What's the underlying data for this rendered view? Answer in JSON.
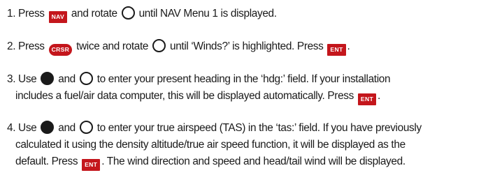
{
  "keys": {
    "nav": "NAV",
    "crsr": "CRSR",
    "ent": "ENT"
  },
  "icons": {
    "outer_knob": "outer-knob-icon",
    "inner_knob": "inner-knob-icon"
  },
  "colors": {
    "key_background": "#c4161c",
    "key_text": "#ffffff",
    "text": "#1a1a1a"
  },
  "steps": [
    {
      "a": "1. Press ",
      "b": " and rotate ",
      "c": " until NAV Menu 1 is displayed."
    },
    {
      "a": "2. Press ",
      "b": " twice and rotate ",
      "c": " until ‘Winds?’ is highlighted. Press ",
      "d": "."
    },
    {
      "a": "3. Use ",
      "b": " and ",
      "c": " to enter your present heading in the ‘hdg:’ field. If your installation",
      "d": "includes a fuel/air data computer, this will be displayed automatically. Press ",
      "e": "."
    },
    {
      "a": "4. Use ",
      "b": " and ",
      "c": " to enter your true airspeed (TAS) in the ‘tas:’ field. If you have previously",
      "d": "calculated it using the density altitude/true air speed function, it will be displayed as the",
      "e": "default. Press ",
      "f": ". The wind direction and speed and head/tail wind will be displayed."
    }
  ]
}
